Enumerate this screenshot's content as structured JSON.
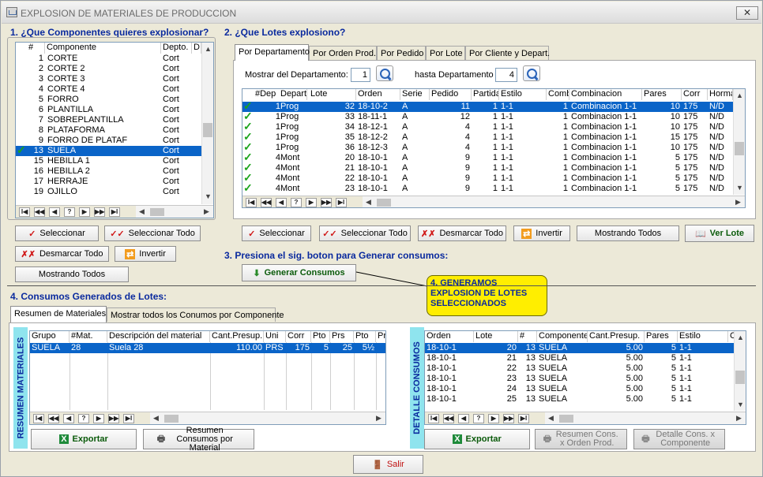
{
  "window": {
    "title": "EXPLOSION DE MATERIALES DE PRODUCCION",
    "close": "✕"
  },
  "section1": {
    "title": "1. ¿Que Componentes quieres explosionar?",
    "columns": [
      "#",
      "Componente",
      "Depto.",
      "D"
    ],
    "rows": [
      {
        "n": "1",
        "comp": "CORTE",
        "dep": "Cort",
        "checked": false,
        "sel": false
      },
      {
        "n": "2",
        "comp": "CORTE 2",
        "dep": "Cort",
        "checked": false,
        "sel": false
      },
      {
        "n": "3",
        "comp": "CORTE 3",
        "dep": "Cort",
        "checked": false,
        "sel": false
      },
      {
        "n": "4",
        "comp": "CORTE 4",
        "dep": "Cort",
        "checked": false,
        "sel": false
      },
      {
        "n": "5",
        "comp": "FORRO",
        "dep": "Cort",
        "checked": false,
        "sel": false
      },
      {
        "n": "6",
        "comp": "PLANTILLA",
        "dep": "Cort",
        "checked": false,
        "sel": false
      },
      {
        "n": "7",
        "comp": "SOBREPLANTILLA",
        "dep": "Cort",
        "checked": false,
        "sel": false
      },
      {
        "n": "8",
        "comp": "PLATAFORMA",
        "dep": "Cort",
        "checked": false,
        "sel": false
      },
      {
        "n": "9",
        "comp": "FORRO DE PLATAF",
        "dep": "Cort",
        "checked": false,
        "sel": false
      },
      {
        "n": "13",
        "comp": "SUELA",
        "dep": "Cort",
        "checked": true,
        "sel": true
      },
      {
        "n": "15",
        "comp": "HEBILLA 1",
        "dep": "Cort",
        "checked": false,
        "sel": false
      },
      {
        "n": "16",
        "comp": "HEBILLA 2",
        "dep": "Cort",
        "checked": false,
        "sel": false
      },
      {
        "n": "17",
        "comp": "HERRAJE",
        "dep": "Cort",
        "checked": false,
        "sel": false
      },
      {
        "n": "19",
        "comp": "OJILLO",
        "dep": "Cort",
        "checked": false,
        "sel": false
      }
    ],
    "nav": [
      "I◀",
      "◀◀",
      "◀",
      "?",
      "▶",
      "▶▶",
      "▶I"
    ],
    "buttons": {
      "select": "Seleccionar",
      "select_all": "Seleccionar Todo",
      "unmark_all": "Desmarcar Todo",
      "invert": "Invertir",
      "showing_all": "Mostrando Todos"
    }
  },
  "section2": {
    "title": "2. ¿Que Lotes explosiono?",
    "tabs": [
      "Por Departamento",
      "Por Orden Prod.",
      "Por Pedido",
      "Por Lote",
      "Por Cliente y Depart."
    ],
    "from_label": "Mostrar del Departamento:",
    "from_value": "1",
    "to_label": "hasta Departamento",
    "to_value": "4",
    "columns": [
      "#Dep",
      "Depart",
      "Lote",
      "Orden",
      "Serie",
      "Pedido",
      "Partida",
      "Estilo",
      "Comb",
      "Combinacion",
      "Pares",
      "Corr",
      "Horma"
    ],
    "rows": [
      [
        "1",
        "Prog",
        "32",
        "18-10-2",
        "A",
        "11",
        "1",
        "1-1",
        "1",
        "Combinacion 1-1",
        "10",
        "175",
        "N/D"
      ],
      [
        "1",
        "Prog",
        "33",
        "18-11-1",
        "A",
        "12",
        "1",
        "1-1",
        "1",
        "Combinacion 1-1",
        "10",
        "175",
        "N/D"
      ],
      [
        "1",
        "Prog",
        "34",
        "18-12-1",
        "A",
        "4",
        "1",
        "1-1",
        "1",
        "Combinacion 1-1",
        "10",
        "175",
        "N/D"
      ],
      [
        "1",
        "Prog",
        "35",
        "18-12-2",
        "A",
        "4",
        "1",
        "1-1",
        "1",
        "Combinacion 1-1",
        "15",
        "175",
        "N/D"
      ],
      [
        "1",
        "Prog",
        "36",
        "18-12-3",
        "A",
        "4",
        "1",
        "1-1",
        "1",
        "Combinacion 1-1",
        "10",
        "175",
        "N/D"
      ],
      [
        "4",
        "Mont",
        "20",
        "18-10-1",
        "A",
        "9",
        "1",
        "1-1",
        "1",
        "Combinacion 1-1",
        "5",
        "175",
        "N/D"
      ],
      [
        "4",
        "Mont",
        "21",
        "18-10-1",
        "A",
        "9",
        "1",
        "1-1",
        "1",
        "Combinacion 1-1",
        "5",
        "175",
        "N/D"
      ],
      [
        "4",
        "Mont",
        "22",
        "18-10-1",
        "A",
        "9",
        "1",
        "1-1",
        "1",
        "Combinacion 1-1",
        "5",
        "175",
        "N/D"
      ],
      [
        "4",
        "Mont",
        "23",
        "18-10-1",
        "A",
        "9",
        "1",
        "1-1",
        "1",
        "Combinacion 1-1",
        "5",
        "175",
        "N/D"
      ]
    ],
    "nav": [
      "I◀",
      "◀◀",
      "◀",
      "?",
      "▶",
      "▶▶",
      "▶I"
    ],
    "buttons": {
      "select": "Seleccionar",
      "select_all": "Seleccionar Todo",
      "unmark_all": "Desmarcar Todo",
      "invert": "Invertir",
      "showing_all": "Mostrando Todos",
      "view_lot": "Ver Lote"
    }
  },
  "section3": {
    "title": "3. Presiona el sig. boton para Generar consumos:",
    "generate": "Generar Consumos",
    "note": "4. GENERAMOS EXPLOSION DE LOTES SELECCIONADOS"
  },
  "section4": {
    "title": "4. Consumos Generados de Lotes:",
    "tabs": [
      "Resumen de Materiales",
      "Mostrar todos los Conumos por Componente"
    ],
    "left_vertical": "RESUMEN MATERIALES",
    "right_vertical": "DETALLE CONSUMOS",
    "summary_columns": [
      "Grupo",
      "#Mat.",
      "Descripción del material",
      "Cant.Presup.",
      "Uni",
      "Corr",
      "Pto",
      "Prs",
      "Pto",
      "Pr"
    ],
    "summary_rows": [
      [
        "SUELA",
        "28",
        "Suela 28",
        "110.00",
        "PRS",
        "175",
        "5",
        "25",
        "5½",
        ""
      ]
    ],
    "detail_columns": [
      "Orden",
      "Lote",
      "#",
      "Componente",
      "Cant.Presup.",
      "Pares",
      "Estilo",
      "C"
    ],
    "detail_rows": [
      [
        "18-10-1",
        "20",
        "13",
        "SUELA",
        "5.00",
        "5",
        "1-1"
      ],
      [
        "18-10-1",
        "21",
        "13",
        "SUELA",
        "5.00",
        "5",
        "1-1"
      ],
      [
        "18-10-1",
        "22",
        "13",
        "SUELA",
        "5.00",
        "5",
        "1-1"
      ],
      [
        "18-10-1",
        "23",
        "13",
        "SUELA",
        "5.00",
        "5",
        "1-1"
      ],
      [
        "18-10-1",
        "24",
        "13",
        "SUELA",
        "5.00",
        "5",
        "1-1"
      ],
      [
        "18-10-1",
        "25",
        "13",
        "SUELA",
        "5.00",
        "5",
        "1-1"
      ]
    ],
    "nav": [
      "I◀",
      "◀◀",
      "◀",
      "?",
      "▶",
      "▶▶",
      "▶I"
    ],
    "buttons": {
      "export": "Exportar",
      "summary_consumption": "Resumen Consumos por Material",
      "export2": "Exportar",
      "summary_cons_order": "Resumen Cons. x Orden Prod.",
      "detail_cons_comp": "Detalle Cons. x Componente",
      "exit": "Salir"
    }
  },
  "colors": {
    "selection": "#0a64c8",
    "section_title": "#0a2a9e",
    "note_bg": "#ffee00",
    "vertical_label_bg": "#8fe4ee"
  }
}
